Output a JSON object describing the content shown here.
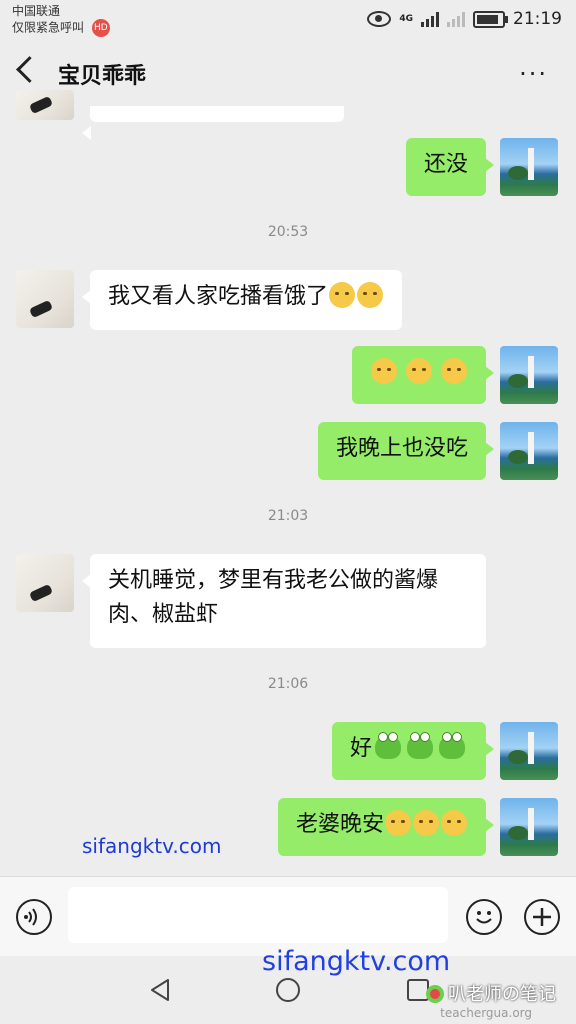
{
  "status_bar": {
    "carrier_line1": "中国联通",
    "carrier_line2": "仅限紧急呼叫",
    "network": "4G",
    "time": "21:19"
  },
  "header": {
    "title": "宝贝乖乖",
    "more_label": "···"
  },
  "messages": [
    {
      "side": "right",
      "text": "还没"
    },
    {
      "type": "time",
      "text": "20:53"
    },
    {
      "side": "left",
      "text": "我又看人家吃播看饿了"
    },
    {
      "side": "right",
      "text": ""
    },
    {
      "side": "right",
      "text": "我晚上也没吃"
    },
    {
      "type": "time",
      "text": "21:03"
    },
    {
      "side": "left",
      "text": "关机睡觉，梦里有我老公做的酱爆肉、椒盐虾"
    },
    {
      "type": "time",
      "text": "21:06"
    },
    {
      "side": "right",
      "text": "好"
    },
    {
      "side": "right",
      "text": "老婆晚安"
    }
  ],
  "watermarks": {
    "site_small": "sifangktv.com",
    "site_large": "sifangktv.com",
    "brand": "叭老师の笔记",
    "brand_url": "teachergua.org"
  },
  "icons": {
    "voice": "voice-icon",
    "emoji": "emoji-icon",
    "plus": "plus-icon",
    "back": "back-icon",
    "more": "more-icon"
  },
  "colors": {
    "bubble_green": "#95ec69",
    "bubble_white": "#ffffff",
    "background": "#ededed"
  }
}
